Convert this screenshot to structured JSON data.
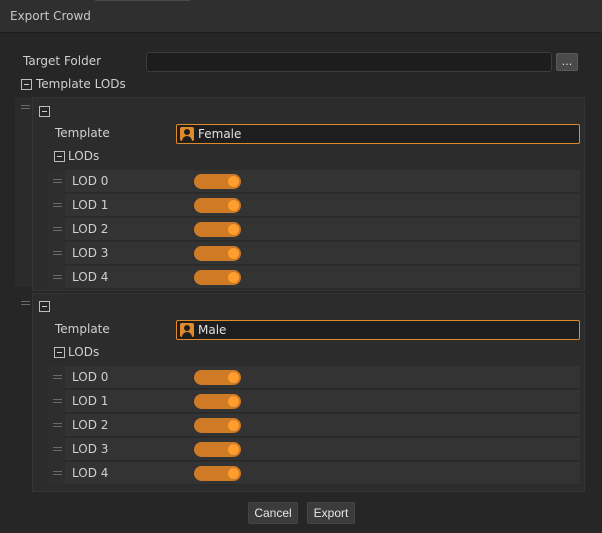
{
  "window": {
    "title": "Export Crowd"
  },
  "target_folder": {
    "label": "Target Folder",
    "value": "",
    "browse_label": "..."
  },
  "template_lods": {
    "label": "Template LODs"
  },
  "groups": [
    {
      "template_label": "Template",
      "template_value": "Female",
      "lods_label": "LODs",
      "lods": [
        {
          "label": "LOD 0",
          "enabled": true
        },
        {
          "label": "LOD 1",
          "enabled": true
        },
        {
          "label": "LOD 2",
          "enabled": true
        },
        {
          "label": "LOD 3",
          "enabled": true
        },
        {
          "label": "LOD 4",
          "enabled": true
        }
      ]
    },
    {
      "template_label": "Template",
      "template_value": "Male",
      "lods_label": "LODs",
      "lods": [
        {
          "label": "LOD 0",
          "enabled": true
        },
        {
          "label": "LOD 1",
          "enabled": true
        },
        {
          "label": "LOD 2",
          "enabled": true
        },
        {
          "label": "LOD 3",
          "enabled": true
        },
        {
          "label": "LOD 4",
          "enabled": true
        }
      ]
    }
  ],
  "footer": {
    "cancel_label": "Cancel",
    "export_label": "Export"
  },
  "colors": {
    "accent": "#e08a2c",
    "background": "#262626",
    "panel": "#2c2c2c"
  },
  "icons": {
    "template": "person-icon",
    "collapse": "minus-box-icon",
    "drag": "drag-handle-icon"
  }
}
